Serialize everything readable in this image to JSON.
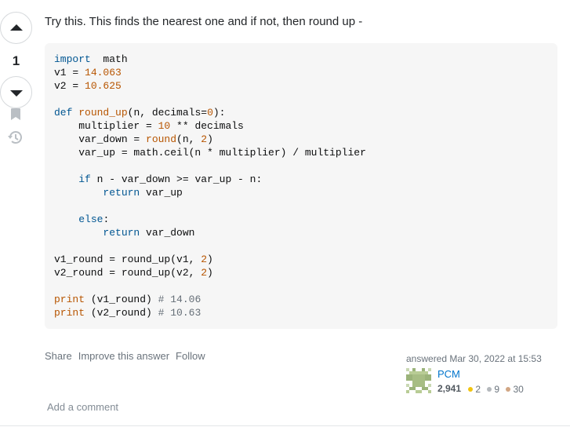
{
  "vote": {
    "count": "1"
  },
  "post": {
    "text": "Try this. This finds the nearest one and if not, then round up -"
  },
  "code_lines": [
    [
      [
        "kw",
        "import"
      ],
      [
        "",
        "  math"
      ]
    ],
    [
      [
        "",
        "v1 = "
      ],
      [
        "num",
        "14.063"
      ]
    ],
    [
      [
        "",
        "v2 = "
      ],
      [
        "num",
        "10.625"
      ]
    ],
    [],
    [
      [
        "kw",
        "def"
      ],
      [
        "",
        " "
      ],
      [
        "fn",
        "round_up"
      ],
      [
        "",
        "(n, decimals="
      ],
      [
        "num",
        "0"
      ],
      [
        "",
        "):"
      ]
    ],
    [
      [
        "",
        "    multiplier = "
      ],
      [
        "num",
        "10"
      ],
      [
        "",
        " ** decimals"
      ]
    ],
    [
      [
        "",
        "    var_down = "
      ],
      [
        "fn",
        "round"
      ],
      [
        "",
        "(n, "
      ],
      [
        "num",
        "2"
      ],
      [
        "",
        ")"
      ]
    ],
    [
      [
        "",
        "    var_up = math.ceil(n * multiplier) / multiplier"
      ]
    ],
    [],
    [
      [
        "",
        "    "
      ],
      [
        "kw",
        "if"
      ],
      [
        "",
        " n - var_down >= var_up - n:"
      ]
    ],
    [
      [
        "",
        "        "
      ],
      [
        "kw",
        "return"
      ],
      [
        "",
        " var_up"
      ]
    ],
    [],
    [
      [
        "",
        "    "
      ],
      [
        "kw",
        "else"
      ],
      [
        "",
        ":"
      ]
    ],
    [
      [
        "",
        "        "
      ],
      [
        "kw",
        "return"
      ],
      [
        "",
        " var_down"
      ]
    ],
    [],
    [
      [
        "",
        "v1_round = round_up(v1, "
      ],
      [
        "num",
        "2"
      ],
      [
        "",
        ")"
      ]
    ],
    [
      [
        "",
        "v2_round = round_up(v2, "
      ],
      [
        "num",
        "2"
      ],
      [
        "",
        ")"
      ]
    ],
    [],
    [
      [
        "fn",
        "print"
      ],
      [
        "",
        " (v1_round) "
      ],
      [
        "cm",
        "# 14.06"
      ]
    ],
    [
      [
        "fn",
        "print"
      ],
      [
        "",
        " (v2_round) "
      ],
      [
        "cm",
        "# 10.63"
      ]
    ]
  ],
  "actions": {
    "share": "Share",
    "improve": "Improve this answer",
    "follow": "Follow"
  },
  "user": {
    "answered": "answered Mar 30, 2022 at 15:53",
    "name": "PCM",
    "reputation": "2,941",
    "gold": "2",
    "silver": "9",
    "bronze": "30"
  },
  "add_comment": "Add a comment",
  "colors": {
    "gold": "#f1c40f",
    "silver": "#b4b8bc",
    "bronze": "#d1a684",
    "link": "#0074cc"
  }
}
